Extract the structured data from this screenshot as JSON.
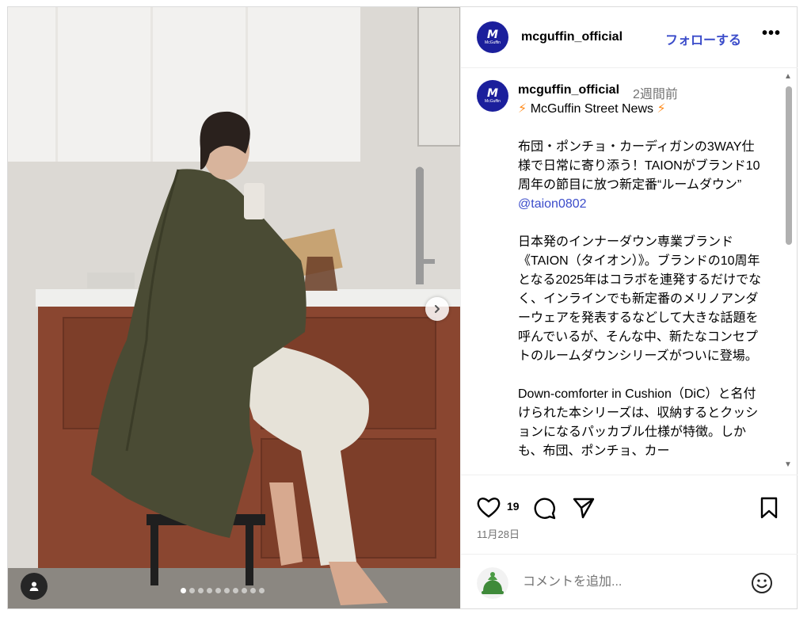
{
  "post": {
    "username": "mcguffin_official",
    "follow_label": "フォローする",
    "more_label": "•••",
    "avatar_mark": "M",
    "avatar_sub": "McGuffin"
  },
  "carousel": {
    "total_slides": 10,
    "current_slide": 1
  },
  "caption": {
    "username": "mcguffin_official",
    "time_ago": "2週間前",
    "headline_bolt": "⚡",
    "headline": "McGuffin Street News",
    "para1": "布団・ポンチョ・カーディガンの3WAY仕様で日常に寄り添う！TAIONがブランド10周年の節目に放つ新定番“ルームダウン”",
    "mention": "@taion0802",
    "para2": "日本発のインナーダウン専業ブランド《TAION（タイオン）》。ブランドの10周年となる2025年はコラボを連発するだけでなく、インラインでも新定番のメリノアンダーウェアを発表するなどして大きな話題を呼んでいるが、そんな中、新たなコンセプトのルームダウンシリーズがついに登場。",
    "para3": "Down-comforter in Cushion（DiC）と名付けられた本シリーズは、収納するとクッションになるパッカブル仕様が特徴。しかも、布団、ポンチョ、カー"
  },
  "actions": {
    "like_count": "19",
    "date": "11月28日"
  },
  "comment": {
    "placeholder": "コメントを追加..."
  },
  "colors": {
    "link_blue": "#3b4cca",
    "brand_navy": "#1b1f9c",
    "muted": "#737373"
  }
}
